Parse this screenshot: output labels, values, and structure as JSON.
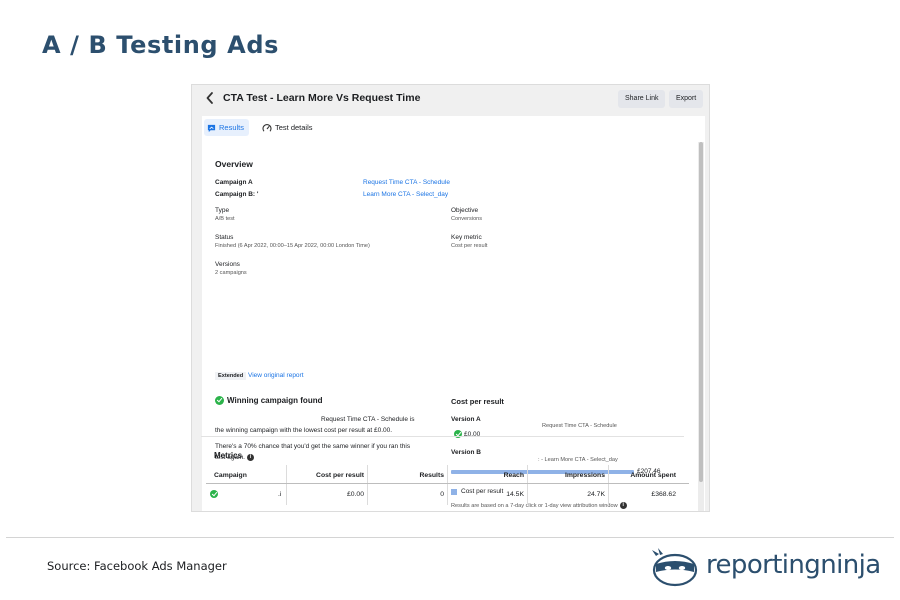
{
  "slide": {
    "title": "A / B Testing Ads",
    "source": "Source: Facebook Ads Manager",
    "logo_text": "reportingninja"
  },
  "window": {
    "title": "CTA Test - Learn More Vs Request Time",
    "share_label": "Share Link",
    "export_label": "Export"
  },
  "tabs": [
    {
      "label": "Results",
      "active": true
    },
    {
      "label": "Test details",
      "active": false
    }
  ],
  "overview": {
    "heading": "Overview",
    "campaign_a_label": "Campaign A",
    "campaign_a_value": "Request Time CTA - Schedule",
    "campaign_b_label": "Campaign B: '",
    "campaign_b_value": "Learn More CTA - Select_day",
    "type_label": "Type",
    "type_value": "A/B test",
    "objective_label": "Objective",
    "objective_value": "Conversions",
    "status_label": "Status",
    "status_value": "Finished (6 Apr 2022, 00:00–15 Apr 2022, 00:00 London Time)",
    "key_metric_label": "Key metric",
    "key_metric_value": "Cost per result",
    "versions_label": "Versions",
    "versions_value": "2 campaigns",
    "extended_tag": "Extended",
    "view_report_link": "View original report"
  },
  "winner": {
    "heading": "Winning campaign found",
    "line1": "Request Time CTA - Schedule is",
    "line2": "the winning campaign with the lowest cost per result at £0.00.",
    "chance_line1": "There's a 70% chance that you'd get the same winner if you ran this",
    "chance_line2": "test again."
  },
  "cost_chart": {
    "heading": "Cost per result",
    "version_a_label": "Version A",
    "version_a_campaign": "Request Time CTA - Schedule",
    "version_a_value": "£0.00",
    "version_a_amount": 0.0,
    "version_b_label": "Version B",
    "version_b_campaign": ": - Learn More CTA - Select_day",
    "version_b_value": "£207.46",
    "version_b_amount": 207.46,
    "legend_label": "Cost per result",
    "footnote": "Results are based on a 7-day click or 1-day view attribution window",
    "colors": {
      "bar": "#8fb2e7",
      "winner": "#2bb34a"
    }
  },
  "metrics": {
    "heading": "Metrics",
    "columns": [
      "Campaign",
      "Cost per result",
      "Results",
      "Reach",
      "Impressions",
      "Amount spent"
    ],
    "rows": [
      {
        "campaign": ".i",
        "cost_per_result": "£0.00",
        "results": "0",
        "reach": "14.5K",
        "impressions": "24.7K",
        "amount_spent": "£368.62"
      }
    ]
  }
}
